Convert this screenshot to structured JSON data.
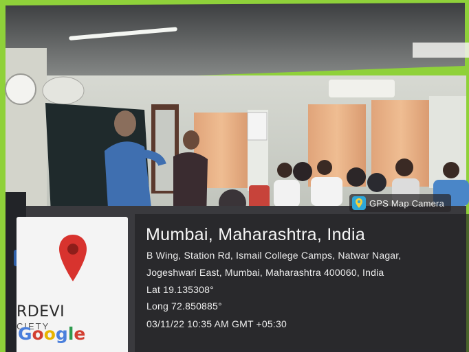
{
  "badge": {
    "label": "GPS Map Camera"
  },
  "location": {
    "title": "Mumbai, Maharashtra, India",
    "address_line1": "B Wing, Station Rd, Ismail College Camps, Natwar Nagar,",
    "address_line2": "Jogeshwari East, Mumbai, Maharashtra 400060, India",
    "latitude": "Lat 19.135308°",
    "longitude": "Long 72.850885°",
    "timestamp": "03/11/22 10:35 AM GMT +05:30"
  },
  "map": {
    "street_label": "RDEVI",
    "street_label_cut": "CIETY",
    "google_logo": {
      "g1": "G",
      "o1": "o",
      "o2": "o",
      "g2": "g",
      "l": "l",
      "e": "e"
    }
  },
  "colors": {
    "pin": "#d8332e",
    "panel": "#1e1e22",
    "badge_icon": "#2fa7d8",
    "frame": "#8fd13a"
  }
}
